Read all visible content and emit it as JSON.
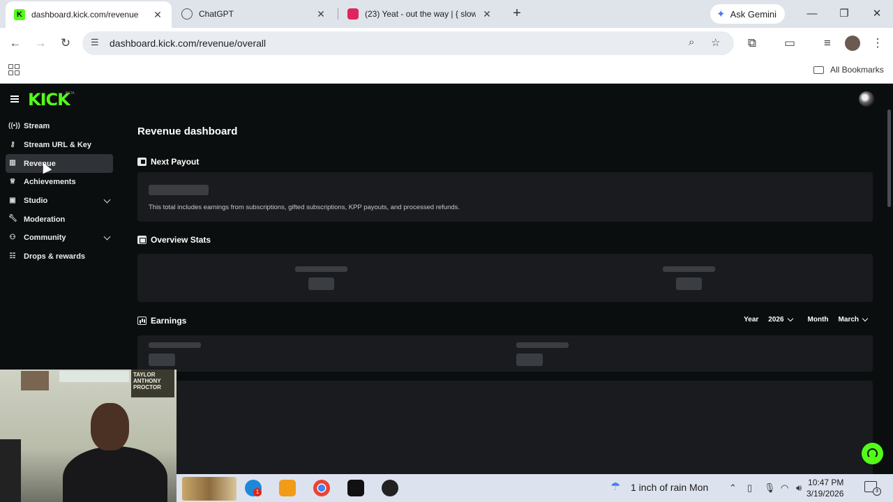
{
  "browser": {
    "tabs": [
      {
        "title": "dashboard.kick.com/revenue",
        "active": true
      },
      {
        "title": "ChatGPT",
        "active": false
      },
      {
        "title": "(23) Yeat - out the way | { slowe",
        "active": false
      }
    ],
    "ask_gemini_label": "Ask Gemini",
    "url": "dashboard.kick.com/revenue/overall",
    "bookmarks_label": "All Bookmarks"
  },
  "app": {
    "logo": "KICK",
    "logo_sup": "BETA",
    "brand_color": "#53fc18",
    "sidebar": {
      "items": [
        {
          "label": "Stream",
          "icon": "broadcast-icon"
        },
        {
          "label": "Stream URL & Key",
          "icon": "key-icon"
        },
        {
          "label": "Revenue",
          "icon": "chart-icon",
          "active": true
        },
        {
          "label": "Achievements",
          "icon": "trophy-icon"
        },
        {
          "label": "Studio",
          "icon": "studio-icon",
          "expandable": true
        },
        {
          "label": "Moderation",
          "icon": "wrench-icon"
        },
        {
          "label": "Community",
          "icon": "community-icon",
          "expandable": true
        },
        {
          "label": "Drops & rewards",
          "icon": "drops-icon"
        }
      ]
    },
    "page_title": "Revenue dashboard",
    "next_payout": {
      "title": "Next Payout",
      "note": "This total includes earnings from subscriptions, gifted subscriptions, KPP payouts, and processed refunds."
    },
    "overview_stats": {
      "title": "Overview Stats"
    },
    "earnings": {
      "title": "Earnings",
      "year_label": "Year",
      "year_value": "2026",
      "month_label": "Month",
      "month_value": "March"
    }
  },
  "webcam": {
    "poster_text": "TAYLOR ANTHONY PROCTOR"
  },
  "taskbar": {
    "weather": "1 inch of rain Mon",
    "time": "10:47 PM",
    "date": "3/19/2026",
    "notification_count": "3",
    "badge_count": "1"
  }
}
